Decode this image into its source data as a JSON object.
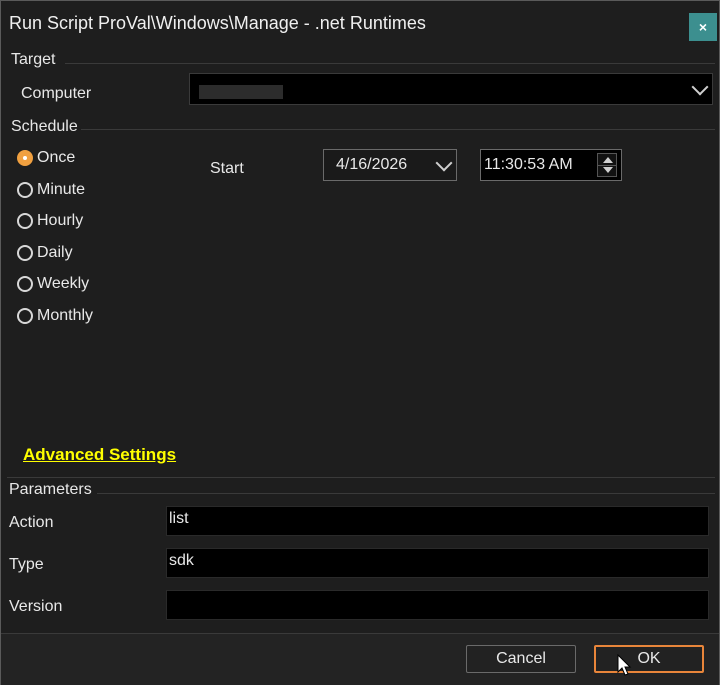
{
  "window": {
    "title": "Run Script ProVal\\Windows\\Manage - .net Runtimes",
    "close_label": "×"
  },
  "target": {
    "section_label": "Target",
    "computer_label": "Computer",
    "computer_value": ""
  },
  "schedule": {
    "section_label": "Schedule",
    "options": [
      {
        "label": "Once",
        "checked": true
      },
      {
        "label": "Minute",
        "checked": false
      },
      {
        "label": "Hourly",
        "checked": false
      },
      {
        "label": "Daily",
        "checked": false
      },
      {
        "label": "Weekly",
        "checked": false
      },
      {
        "label": "Monthly",
        "checked": false
      }
    ],
    "start_label": "Start",
    "start_date": "4/16/2026",
    "start_time": "11:30:53 AM"
  },
  "advanced_settings_label": "Advanced Settings",
  "parameters": {
    "section_label": "Parameters",
    "fields": [
      {
        "label": "Action",
        "value": "list"
      },
      {
        "label": "Type",
        "value": "sdk"
      },
      {
        "label": "Version",
        "value": ""
      }
    ]
  },
  "buttons": {
    "cancel": "Cancel",
    "ok": "OK"
  },
  "colors": {
    "accent": "#f0a040",
    "link": "#ffff00",
    "close_bg": "#3c8f8f",
    "ok_border": "#e8853a"
  }
}
